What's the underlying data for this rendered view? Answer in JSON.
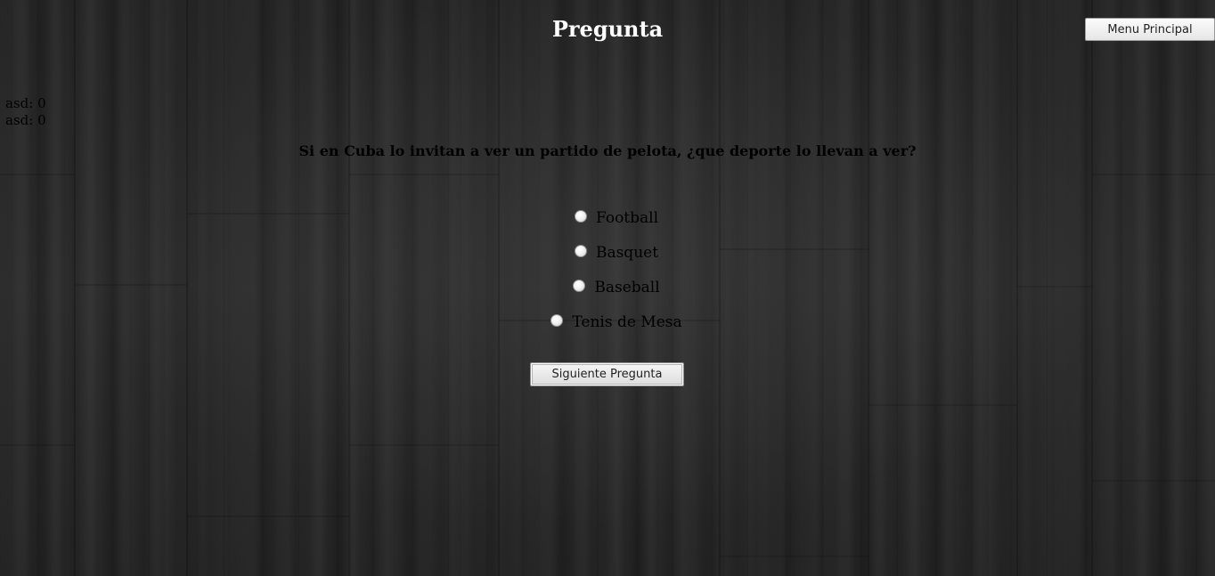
{
  "header": {
    "title": "Pregunta",
    "menu_button_label": "Menu Principal"
  },
  "scores": [
    {
      "text": "asd: 0"
    },
    {
      "text": "asd: 0"
    }
  ],
  "quiz": {
    "question": "Si en Cuba lo invitan a ver un partido de pelota, ¿que deporte lo llevan a ver?",
    "options": [
      {
        "label": "Football",
        "selected": false
      },
      {
        "label": "Basquet",
        "selected": false
      },
      {
        "label": "Baseball",
        "selected": false
      },
      {
        "label": "Tenis de Mesa",
        "selected": false
      }
    ],
    "next_button_label": "Siguiente Pregunta"
  },
  "colors": {
    "background": "#2a2a2a",
    "title": "#ffffff",
    "text": "#000000"
  }
}
